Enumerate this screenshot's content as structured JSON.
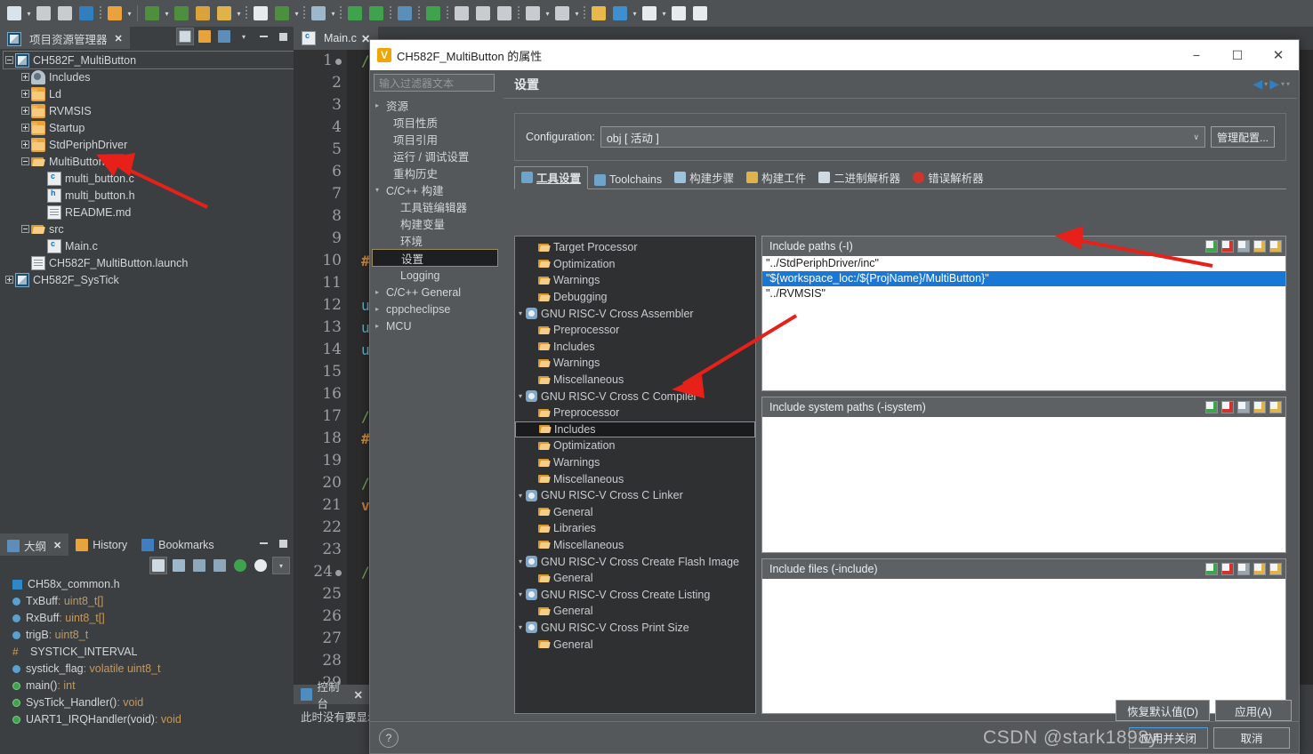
{
  "toolbar": {
    "items": [
      {
        "name": "new-file-button",
        "color": "#d9e3ea",
        "arrow": true
      },
      {
        "name": "save-button",
        "color": "#c8ccd0",
        "arrow": false
      },
      {
        "name": "save-all-button",
        "color": "#c8ccd0",
        "arrow": false
      },
      {
        "name": "build-project-button",
        "color": "#2f7fc1",
        "arrow": false
      },
      {
        "name": "new-window-button",
        "color": "#e8a33d",
        "arrow": true
      },
      {
        "name": "separator",
        "color": "",
        "arrow": false
      },
      {
        "name": "build-all-button",
        "color": "#4d8f3f",
        "arrow": true
      },
      {
        "name": "clean-button",
        "color": "#4d8f3f",
        "arrow": false
      },
      {
        "name": "books-button",
        "color": "#d9a23a",
        "arrow": false
      },
      {
        "name": "download-button",
        "color": "#e0b24a",
        "arrow": true
      },
      {
        "name": "terminal-button",
        "color": "#e8ebed",
        "arrow": false
      },
      {
        "name": "debug-button",
        "color": "#4d8f3f",
        "arrow": true
      },
      {
        "name": "search-button",
        "color": "#9bb8cc",
        "arrow": true
      },
      {
        "name": "download-flash-button",
        "color": "#3fa34d",
        "arrow": false
      },
      {
        "name": "info-button",
        "color": "#3fa34d",
        "arrow": false
      },
      {
        "name": "console-button",
        "color": "#5b8fb9",
        "arrow": false
      },
      {
        "name": "perspective-button",
        "color": "#3fa34d",
        "arrow": false
      },
      {
        "name": "indent-left-button",
        "color": "#c8ccd0",
        "arrow": false
      },
      {
        "name": "indent-right-button",
        "color": "#c8ccd0",
        "arrow": false
      },
      {
        "name": "ruler-button",
        "color": "#c8ccd0",
        "arrow": false
      },
      {
        "name": "next-annotation-button",
        "color": "#c8ccd0",
        "arrow": true
      },
      {
        "name": "previous-annotation-button",
        "color": "#c8ccd0",
        "arrow": true
      },
      {
        "name": "last-edit-button",
        "color": "#e8b84a",
        "arrow": false
      },
      {
        "name": "back-button",
        "color": "#3f8fd0",
        "arrow": true
      },
      {
        "name": "forward-button",
        "color": "#e8ebed",
        "arrow": true
      },
      {
        "name": "undo-button",
        "color": "#e8ebed",
        "arrow": false
      },
      {
        "name": "redo-button",
        "color": "#e8ebed",
        "arrow": false
      }
    ]
  },
  "project_explorer": {
    "tab_label": "项目资源管理器",
    "close_glyph": "✕",
    "toolbar_buttons": [
      "collapse-all-icon",
      "link-with-editor-icon",
      "view-menu-icon",
      "minimize-icon",
      "maximize-icon"
    ],
    "tree": [
      {
        "label": "CH582F_MultiButton",
        "icon": "project-icon",
        "depth": 0,
        "expander": "minus",
        "selected": true
      },
      {
        "label": "Includes",
        "icon": "includes-icon",
        "depth": 1,
        "expander": "plus",
        "selected": false
      },
      {
        "label": "Ld",
        "icon": "folder-icon",
        "depth": 1,
        "expander": "plus",
        "selected": false
      },
      {
        "label": "RVMSIS",
        "icon": "folder-icon",
        "depth": 1,
        "expander": "plus",
        "selected": false
      },
      {
        "label": "Startup",
        "icon": "folder-icon",
        "depth": 1,
        "expander": "plus",
        "selected": false
      },
      {
        "label": "StdPeriphDriver",
        "icon": "folder-icon",
        "depth": 1,
        "expander": "plus",
        "selected": false
      },
      {
        "label": "MultiButton",
        "icon": "folder-open-icon",
        "depth": 1,
        "expander": "minus",
        "selected": false
      },
      {
        "label": "multi_button.c",
        "icon": "c-file-icon",
        "depth": 2,
        "expander": "none",
        "selected": false
      },
      {
        "label": "multi_button.h",
        "icon": "h-file-icon",
        "depth": 2,
        "expander": "none",
        "selected": false
      },
      {
        "label": "README.md",
        "icon": "text-file-icon",
        "depth": 2,
        "expander": "none",
        "selected": false
      },
      {
        "label": "src",
        "icon": "folder-open-icon",
        "depth": 1,
        "expander": "minus",
        "selected": false
      },
      {
        "label": "Main.c",
        "icon": "c-file-icon",
        "depth": 2,
        "expander": "none",
        "selected": false
      },
      {
        "label": "CH582F_MultiButton.launch",
        "icon": "launch-file-icon",
        "depth": 1,
        "expander": "none",
        "selected": false
      },
      {
        "label": "CH582F_SysTick",
        "icon": "project-icon",
        "depth": 0,
        "expander": "plus",
        "selected": false
      }
    ]
  },
  "outline": {
    "tabs": [
      {
        "label": "大纲",
        "icon": "outline-icon",
        "active": true,
        "closable": true
      },
      {
        "label": "History",
        "icon": "history-icon",
        "active": false,
        "closable": false
      },
      {
        "label": "Bookmarks",
        "icon": "bookmarks-icon",
        "active": false,
        "closable": false
      }
    ],
    "toolbar_buttons": [
      "collapse-all-icon",
      "sort-icon",
      "hide-fields-icon",
      "hide-static-icon",
      "hide-nonpublic-icon",
      "filters-icon",
      "view-menu-icon"
    ],
    "window_buttons": [
      "minimize-icon",
      "maximize-icon"
    ],
    "items": [
      {
        "name": "CH58x_common.h",
        "type": "",
        "icon": "header-icon"
      },
      {
        "name": "TxBuff",
        "type": " : uint8_t[]",
        "icon": "field-icon"
      },
      {
        "name": "RxBuff",
        "type": " : uint8_t[]",
        "icon": "field-icon"
      },
      {
        "name": "trigB",
        "type": " : uint8_t",
        "icon": "field-icon"
      },
      {
        "name": "SYSTICK_INTERVAL",
        "type": "",
        "icon": "macro-icon"
      },
      {
        "name": "systick_flag",
        "type": " : volatile uint8_t",
        "icon": "field-volatile-icon"
      },
      {
        "name": "main()",
        "type": " : int",
        "icon": "method-icon"
      },
      {
        "name": "SysTick_Handler()",
        "type": " : void",
        "icon": "method-icon"
      },
      {
        "name": "UART1_IRQHandler(void)",
        "type": " : void",
        "icon": "method-icon"
      }
    ]
  },
  "editor": {
    "tab_label": "Main.c",
    "tab_icon": "c-file-icon",
    "close_glyph": "✕",
    "lines": [
      {
        "no": "1",
        "marker": "dot",
        "text": "/",
        "cls": "c-comment"
      },
      {
        "no": "2",
        "marker": "",
        "text": "",
        "cls": ""
      },
      {
        "no": "3",
        "marker": "",
        "text": "",
        "cls": ""
      },
      {
        "no": "4",
        "marker": "",
        "text": "",
        "cls": ""
      },
      {
        "no": "5",
        "marker": "",
        "text": "",
        "cls": ""
      },
      {
        "no": "6",
        "marker": "",
        "text": "",
        "cls": ""
      },
      {
        "no": "7",
        "marker": "",
        "text": "",
        "cls": ""
      },
      {
        "no": "8",
        "marker": "",
        "text": "",
        "cls": ""
      },
      {
        "no": "9",
        "marker": "",
        "text": "",
        "cls": ""
      },
      {
        "no": "10",
        "marker": "",
        "text": "#",
        "cls": "c-pre"
      },
      {
        "no": "11",
        "marker": "",
        "text": "",
        "cls": ""
      },
      {
        "no": "12",
        "marker": "",
        "text": "u",
        "cls": "c-type"
      },
      {
        "no": "13",
        "marker": "",
        "text": "u",
        "cls": "c-type"
      },
      {
        "no": "14",
        "marker": "",
        "text": "u",
        "cls": "c-type"
      },
      {
        "no": "15",
        "marker": "",
        "text": "",
        "cls": ""
      },
      {
        "no": "16",
        "marker": "",
        "text": "",
        "cls": ""
      },
      {
        "no": "17",
        "marker": "",
        "text": "/",
        "cls": "c-comment"
      },
      {
        "no": "18",
        "marker": "",
        "text": "#",
        "cls": "c-pre"
      },
      {
        "no": "19",
        "marker": "",
        "text": "",
        "cls": ""
      },
      {
        "no": "20",
        "marker": "",
        "text": "/",
        "cls": "c-comment"
      },
      {
        "no": "21",
        "marker": "",
        "text": "v",
        "cls": "c-kw"
      },
      {
        "no": "22",
        "marker": "",
        "text": "",
        "cls": ""
      },
      {
        "no": "23",
        "marker": "",
        "text": "",
        "cls": ""
      },
      {
        "no": "24",
        "marker": "dot",
        "text": "/",
        "cls": "c-comment"
      },
      {
        "no": "25",
        "marker": "",
        "text": "",
        "cls": ""
      },
      {
        "no": "26",
        "marker": "",
        "text": "",
        "cls": ""
      },
      {
        "no": "27",
        "marker": "",
        "text": "",
        "cls": ""
      },
      {
        "no": "28",
        "marker": "",
        "text": "",
        "cls": ""
      },
      {
        "no": "29",
        "marker": "",
        "text": "",
        "cls": ""
      }
    ]
  },
  "console": {
    "tab_label": "控制台",
    "tab_icon": "console-icon",
    "close_glyph": "✕",
    "message": "此时没有要显示"
  },
  "dialog": {
    "title": "CH582F_MultiButton 的属性",
    "icon": "mounriver-icon",
    "window_buttons": {
      "minimize": "−",
      "maximize": "☐",
      "close": "✕"
    },
    "filter_placeholder": "输入过滤器文本",
    "nav": {
      "back": "◀",
      "back_caret": "▾",
      "forward": "▶",
      "forward_caret": "▾",
      "menu": "▾"
    },
    "left_tree": [
      {
        "label": "资源",
        "tri": "▸",
        "depth": 0,
        "selected": false
      },
      {
        "label": "项目性质",
        "tri": "",
        "depth": 1,
        "selected": false
      },
      {
        "label": "项目引用",
        "tri": "",
        "depth": 1,
        "selected": false
      },
      {
        "label": "运行 / 调试设置",
        "tri": "",
        "depth": 1,
        "selected": false
      },
      {
        "label": "重构历史",
        "tri": "",
        "depth": 1,
        "selected": false
      },
      {
        "label": "C/C++ 构建",
        "tri": "▾",
        "depth": 0,
        "selected": false
      },
      {
        "label": "工具链编辑器",
        "tri": "",
        "depth": 2,
        "selected": false
      },
      {
        "label": "构建变量",
        "tri": "",
        "depth": 2,
        "selected": false
      },
      {
        "label": "环境",
        "tri": "",
        "depth": 2,
        "selected": false
      },
      {
        "label": "设置",
        "tri": "",
        "depth": 2,
        "selected": true
      },
      {
        "label": "Logging",
        "tri": "",
        "depth": 2,
        "selected": false
      },
      {
        "label": "C/C++ General",
        "tri": "▸",
        "depth": 0,
        "selected": false
      },
      {
        "label": "cppcheclipse",
        "tri": "▸",
        "depth": 0,
        "selected": false
      },
      {
        "label": "MCU",
        "tri": "▸",
        "depth": 0,
        "selected": false
      }
    ],
    "page_title": "设置",
    "configuration": {
      "label": "Configuration:",
      "value": "obj [ 活动 ]",
      "caret": "∨",
      "manage_button": "管理配置..."
    },
    "tabs": [
      {
        "label": "工具设置",
        "icon": "tool-settings-icon",
        "active": true
      },
      {
        "label": "Toolchains",
        "icon": "toolchains-icon",
        "active": false
      },
      {
        "label": "构建步骤",
        "icon": "build-steps-icon",
        "active": false
      },
      {
        "label": "构建工件",
        "icon": "build-artifact-icon",
        "active": false
      },
      {
        "label": "二进制解析器",
        "icon": "binary-parser-icon",
        "active": false
      },
      {
        "label": "错误解析器",
        "icon": "error-parser-icon",
        "active": false
      }
    ],
    "tool_tree": [
      {
        "label": "Target Processor",
        "icon": "folder-icon",
        "depth": 1,
        "tri": "",
        "selected": false
      },
      {
        "label": "Optimization",
        "icon": "folder-icon",
        "depth": 1,
        "tri": "",
        "selected": false
      },
      {
        "label": "Warnings",
        "icon": "folder-icon",
        "depth": 1,
        "tri": "",
        "selected": false
      },
      {
        "label": "Debugging",
        "icon": "folder-icon",
        "depth": 1,
        "tri": "",
        "selected": false
      },
      {
        "label": "GNU RISC-V Cross Assembler",
        "icon": "cog-icon",
        "depth": 0,
        "tri": "▾",
        "selected": false
      },
      {
        "label": "Preprocessor",
        "icon": "folder-icon",
        "depth": 1,
        "tri": "",
        "selected": false
      },
      {
        "label": "Includes",
        "icon": "folder-icon",
        "depth": 1,
        "tri": "",
        "selected": false
      },
      {
        "label": "Warnings",
        "icon": "folder-icon",
        "depth": 1,
        "tri": "",
        "selected": false
      },
      {
        "label": "Miscellaneous",
        "icon": "folder-icon",
        "depth": 1,
        "tri": "",
        "selected": false
      },
      {
        "label": "GNU RISC-V Cross C Compiler",
        "icon": "cog-icon",
        "depth": 0,
        "tri": "▾",
        "selected": false
      },
      {
        "label": "Preprocessor",
        "icon": "folder-icon",
        "depth": 1,
        "tri": "",
        "selected": false
      },
      {
        "label": "Includes",
        "icon": "folder-icon",
        "depth": 1,
        "tri": "",
        "selected": true
      },
      {
        "label": "Optimization",
        "icon": "folder-icon",
        "depth": 1,
        "tri": "",
        "selected": false
      },
      {
        "label": "Warnings",
        "icon": "folder-icon",
        "depth": 1,
        "tri": "",
        "selected": false
      },
      {
        "label": "Miscellaneous",
        "icon": "folder-icon",
        "depth": 1,
        "tri": "",
        "selected": false
      },
      {
        "label": "GNU RISC-V Cross C Linker",
        "icon": "cog-icon",
        "depth": 0,
        "tri": "▾",
        "selected": false
      },
      {
        "label": "General",
        "icon": "folder-icon",
        "depth": 1,
        "tri": "",
        "selected": false
      },
      {
        "label": "Libraries",
        "icon": "folder-icon",
        "depth": 1,
        "tri": "",
        "selected": false
      },
      {
        "label": "Miscellaneous",
        "icon": "folder-icon",
        "depth": 1,
        "tri": "",
        "selected": false
      },
      {
        "label": "GNU RISC-V Cross Create Flash Image",
        "icon": "cog-icon",
        "depth": 0,
        "tri": "▾",
        "selected": false
      },
      {
        "label": "General",
        "icon": "folder-icon",
        "depth": 1,
        "tri": "",
        "selected": false
      },
      {
        "label": "GNU RISC-V Cross Create Listing",
        "icon": "cog-icon",
        "depth": 0,
        "tri": "▾",
        "selected": false
      },
      {
        "label": "General",
        "icon": "folder-icon",
        "depth": 1,
        "tri": "",
        "selected": false
      },
      {
        "label": "GNU RISC-V Cross Print Size",
        "icon": "cog-icon",
        "depth": 0,
        "tri": "▾",
        "selected": false
      },
      {
        "label": "General",
        "icon": "folder-icon",
        "depth": 1,
        "tri": "",
        "selected": false
      }
    ],
    "list_panels": [
      {
        "title": "Include paths (-I)",
        "buttons": [
          "add-icon",
          "delete-icon",
          "edit-icon",
          "move-up-icon",
          "move-down-icon"
        ],
        "items": [
          {
            "value": "\"../StdPeriphDriver/inc\"",
            "selected": false
          },
          {
            "value": "\"${workspace_loc:/${ProjName}/MultiButton}\"",
            "selected": true
          },
          {
            "value": "\"../RVMSIS\"",
            "selected": false
          }
        ]
      },
      {
        "title": "Include system paths (-isystem)",
        "buttons": [
          "add-icon",
          "delete-icon",
          "edit-icon",
          "move-up-icon",
          "move-down-icon"
        ],
        "items": []
      },
      {
        "title": "Include files (-include)",
        "buttons": [
          "add-icon",
          "delete-icon",
          "edit-icon",
          "move-up-icon",
          "move-down-icon"
        ],
        "items": []
      }
    ],
    "action_buttons": [
      {
        "label": "恢复默认值(D)",
        "name": "restore-defaults-button",
        "primary": false
      },
      {
        "label": "应用(A)",
        "name": "apply-button",
        "primary": false
      }
    ],
    "footer_buttons": [
      {
        "label": "应用并关闭",
        "name": "apply-and-close-button",
        "primary": true
      },
      {
        "label": "取消",
        "name": "cancel-button",
        "primary": false
      }
    ],
    "help_glyph": "?"
  },
  "watermark": "CSDN @stark1898y",
  "colors": {
    "accent_blue": "#1978d4",
    "annotation_red": "#e8201a",
    "panel_bg": "#54585a",
    "ide_bg": "#3c3f41"
  }
}
